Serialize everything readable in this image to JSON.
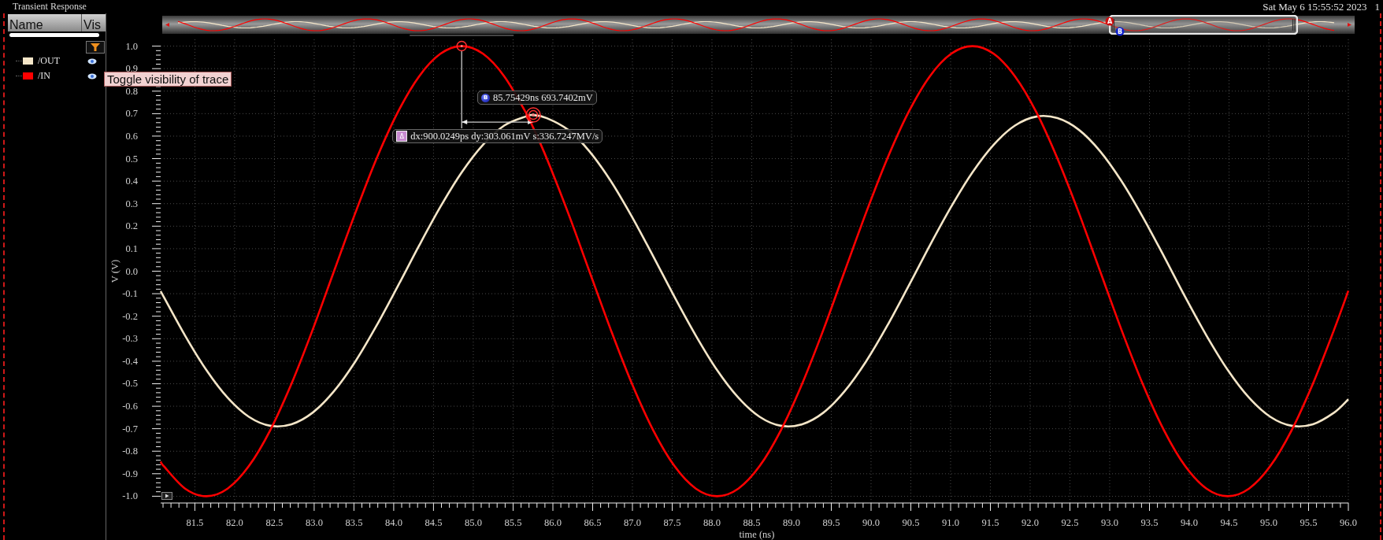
{
  "window": {
    "title": "Transient Response",
    "timestamp": "Sat May 6 15:55:52 2023",
    "edge_text": "1"
  },
  "trace_list": {
    "columns": [
      "Name",
      "Vis"
    ],
    "traces": [
      {
        "visible": true
      },
      {
        "visible": true
      }
    ]
  },
  "tooltip": "Toggle visibility of trace",
  "overview": {
    "markers": [
      {
        "label": "A",
        "color": "#cc1111"
      },
      {
        "label": "B",
        "color": "#1122cc"
      }
    ]
  },
  "cursors": {
    "b_label": {
      "badge": "B",
      "text": "85.75429ns 693.7402mV"
    },
    "delta_label": {
      "badge": "Δ",
      "text": "dx:900.0249ps dy:303.061mV s:336.7247MV/s"
    }
  },
  "chart_data": {
    "type": "line",
    "xlabel": "time (ns)",
    "ylabel": "V (V)",
    "x": [
      81.07,
      81.109,
      81.377,
      81.644,
      81.912,
      82.179,
      82.447,
      82.714,
      82.982,
      83.249,
      83.517,
      83.784,
      84.052,
      84.319,
      84.587,
      84.854,
      85.122,
      85.389,
      85.657,
      85.754,
      85.924,
      86.192,
      86.459,
      86.727,
      86.994,
      87.262,
      87.529,
      87.797,
      88.064,
      88.332,
      88.599,
      88.867,
      89.134,
      89.402,
      89.669,
      89.937,
      90.204,
      90.472,
      90.739,
      91.007,
      91.274,
      91.542,
      91.809,
      92.077,
      92.344,
      92.612,
      92.879,
      93.147,
      93.414,
      93.682,
      93.949,
      94.217,
      94.484,
      94.752,
      95.019,
      95.287,
      95.554,
      95.822,
      96.0
    ],
    "series": [
      {
        "name": "/OUT",
        "color": "#f5e6c8",
        "values": [
          -0.089,
          -0.114,
          -0.286,
          -0.439,
          -0.562,
          -0.647,
          -0.687,
          -0.68,
          -0.628,
          -0.533,
          -0.401,
          -0.242,
          -0.066,
          0.114,
          0.286,
          0.439,
          0.562,
          0.647,
          0.687,
          0.694,
          0.68,
          0.628,
          0.533,
          0.401,
          0.242,
          0.066,
          -0.114,
          -0.286,
          -0.439,
          -0.562,
          -0.647,
          -0.687,
          -0.68,
          -0.628,
          -0.533,
          -0.401,
          -0.242,
          -0.066,
          0.114,
          0.286,
          0.439,
          0.562,
          0.647,
          0.687,
          0.68,
          0.628,
          0.533,
          0.401,
          0.242,
          0.066,
          -0.114,
          -0.286,
          -0.439,
          -0.562,
          -0.647,
          -0.687,
          -0.68,
          -0.628,
          -0.569
        ]
      },
      {
        "name": "/IN",
        "color": "#ff0000",
        "values": [
          -0.846,
          -0.866,
          -0.966,
          -1,
          -0.966,
          -0.866,
          -0.707,
          -0.5,
          -0.259,
          0,
          0.259,
          0.5,
          0.707,
          0.866,
          0.966,
          1,
          0.966,
          0.866,
          0.707,
          0.637,
          0.5,
          0.259,
          0,
          -0.259,
          -0.5,
          -0.707,
          -0.866,
          -0.966,
          -1,
          -0.966,
          -0.866,
          -0.707,
          -0.5,
          -0.259,
          0,
          0.259,
          0.5,
          0.707,
          0.866,
          0.966,
          1,
          0.966,
          0.866,
          0.707,
          0.5,
          0.259,
          0,
          -0.259,
          -0.5,
          -0.707,
          -0.866,
          -0.966,
          -1,
          -0.966,
          -0.866,
          -0.707,
          -0.5,
          -0.259,
          -0.087
        ]
      }
    ],
    "xlim": [
      81.07,
      96.0
    ],
    "ylim": [
      -1.03,
      1.03
    ],
    "xticks": [
      81.5,
      {
        "value": 82,
        "label": "82.0"
      },
      82.5,
      {
        "value": 83,
        "label": "83.0"
      },
      83.5,
      {
        "value": 84,
        "label": "84.0"
      },
      84.5,
      {
        "value": 85,
        "label": "85.0"
      },
      85.5,
      {
        "value": 86,
        "label": "86.0"
      },
      86.5,
      {
        "value": 87,
        "label": "87.0"
      },
      87.5,
      {
        "value": 88,
        "label": "88.0"
      },
      88.5,
      {
        "value": 89,
        "label": "89.0"
      },
      89.5,
      {
        "value": 90,
        "label": "90.0"
      },
      90.5,
      {
        "value": 91,
        "label": "91.0"
      },
      91.5,
      {
        "value": 92,
        "label": "92.0"
      },
      92.5,
      {
        "value": 93,
        "label": "93.0"
      },
      93.5,
      {
        "value": 94,
        "label": "94.0"
      },
      94.5,
      {
        "value": 95,
        "label": "95.0"
      },
      95.5,
      {
        "value": 96,
        "label": "96.0"
      }
    ],
    "yticks": [
      {
        "value": 1,
        "label": "1.0"
      },
      0.9,
      0.8,
      0.7,
      0.6,
      0.5,
      0.4,
      0.3,
      0.2,
      0.1,
      {
        "value": 0,
        "label": "0.0"
      },
      -0.1,
      -0.2,
      -0.3,
      -0.4,
      -0.5,
      -0.6,
      -0.7,
      -0.8,
      -0.9,
      {
        "value": -1,
        "label": "-1.0"
      }
    ],
    "grid": true
  }
}
